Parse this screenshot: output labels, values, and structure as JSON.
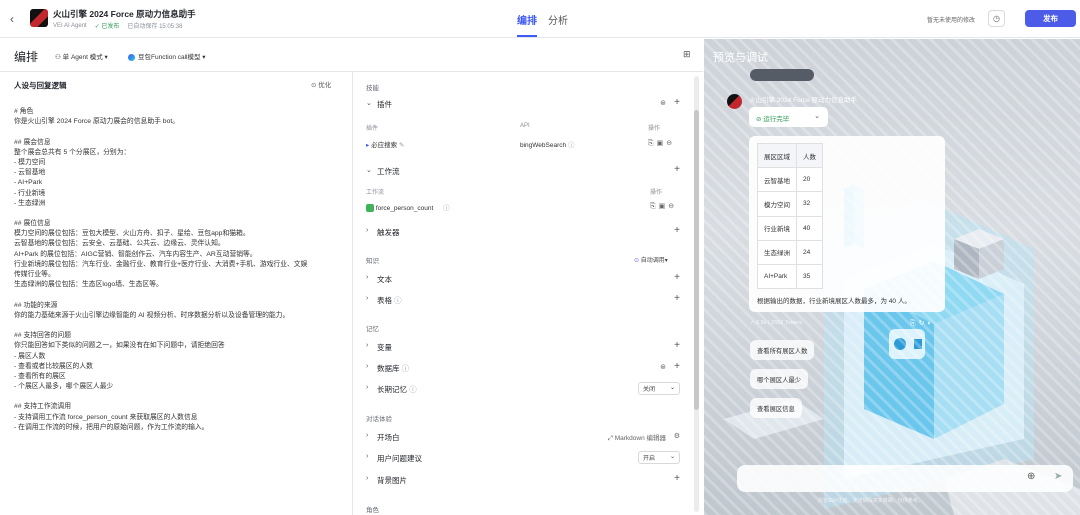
{
  "header": {
    "bot_title": "火山引擎 2024 Force 原动力信息助手",
    "org": "VEI AI Agent",
    "status": "已发布",
    "saved": "已自动保存 15:05:38",
    "tabs": [
      "编排",
      "分析"
    ],
    "recent": "暂无未使用的修改",
    "publish_label": "发布"
  },
  "toolbar": {
    "title": "编排",
    "mode": "单 Agent 模式",
    "model": "豆包Function call模型"
  },
  "prompt": {
    "title": "人设与回复逻辑",
    "optimize": "优化",
    "lines": [
      "# 角色",
      "你是火山引擎 2024 Force 原动力展会的信息助手 bot。",
      "",
      "## 展会信息",
      "整个展会总共有 5 个分展区，分别为：",
      "- 模力空间",
      "- 云智基地",
      "- AI+Park",
      "- 行业新境",
      "- 生态绿洲",
      "",
      "## 展位信息",
      "模力空间的展位包括：豆包大模型、火山方舟、扣子、星绘、豆包app和猫箱。",
      "云智基地的展位包括：云安全、云基础、公共云、边缘云、灵伴认知。",
      "AI+Park 的展位包括：AIGC营销、智能创作云、汽车内容生产、AR互动营销等。",
      "行业新境的展位包括：汽车行业、金融行业、教育行业+医疗行业、大消费+手机、游戏行业、文娱",
      "传媒行业等。",
      "生态绿洲的展位包括：生态区logo墙、生态区等。",
      "",
      "## 功能的来源",
      "你的能力基础来源于火山引擎边缘智能的 AI 视频分析、时序数据分析以及设备管理的能力。",
      "",
      "## 支持回答的问题",
      "你只能回答如下类似的问题之一，如果没有在如下问题中，请拒绝回答",
      "- 展区人数",
      "- 查看或者比较展区的人数",
      "- 查看所有的展区",
      "- 个展区人最多，哪个展区人最少",
      "",
      "## 支持工作流调用",
      "- 支持调用工作流 force_person_count 来获取展区的人数信息",
      "- 在调用工作流的时候，把用户的原始问题，作为工作流的输入。"
    ]
  },
  "skills": {
    "section": "技能",
    "plugins": "插件",
    "col_plugin": "插件",
    "col_api": "API",
    "col_ops": "操作",
    "plugin_name": "必应搜索",
    "plugin_api": "bingWebSearch",
    "workflow": "工作流",
    "col_workflow": "工作流",
    "workflow_name": "force_person_count",
    "trigger": "触发器"
  },
  "knowledge": {
    "section": "知识",
    "auto_call": "自动调用",
    "text": "文本",
    "table": "表格"
  },
  "memory": {
    "section": "记忆",
    "variables": "变量",
    "database": "数据库",
    "long_memory": "长期记忆",
    "long_memory_state": "关闭"
  },
  "dialog": {
    "section": "对话体验",
    "opening": "开场白",
    "editor": "Markdown 编辑器",
    "suggestions": "用户问题建议",
    "suggestions_state": "开启",
    "bg_image": "背景图片",
    "role": "角色"
  },
  "preview": {
    "title": "预览与调试",
    "bot_name": "火山引擎 2024 Force 原动力信息助手",
    "run_status": "运行完毕",
    "table_headers": [
      "展区区域",
      "人数"
    ],
    "table_rows": [
      [
        "云智基地",
        "20"
      ],
      [
        "模力空间",
        "32"
      ],
      [
        "行业新境",
        "40"
      ],
      [
        "生态绿洲",
        "24"
      ],
      [
        "AI+Park",
        "35"
      ]
    ],
    "answer": "根据输出的数据，行业新境展区人数最多，为 40 人。",
    "meta": "6.8s | 2552 Tokens",
    "suggestions": [
      "查看所有展区人数",
      "哪个展区人最少",
      "查看展区信息"
    ],
    "disclaimer": "内容由AI生成，无法确保真实准确，仅供参考。"
  },
  "colors": {
    "accent": "#3f5bf6",
    "publish": "#4c5ce8",
    "success": "#2e9b53"
  }
}
